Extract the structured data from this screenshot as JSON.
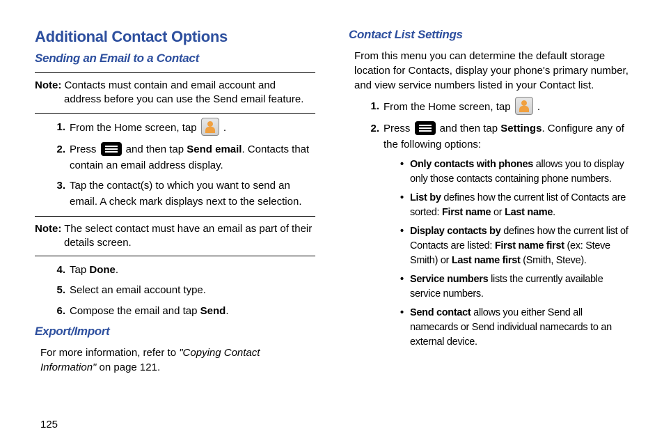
{
  "left": {
    "h1": "Additional Contact Options",
    "h2a": "Sending an Email to a Contact",
    "note1_label": "Note:",
    "note1_text": " Contacts must contain and email account and address before you can use the Send email feature.",
    "steps1": {
      "s1a": "From the Home screen, tap ",
      "s1b": " .",
      "s2a": "Press ",
      "s2b": " and then tap ",
      "s2bold": "Send email",
      "s2c": ". Contacts that contain an email address display.",
      "s3": "Tap the contact(s) to which you want to send an email. A check mark displays next to the selection."
    },
    "note2_label": "Note:",
    "note2_text": " The select contact must have an email as part of their details screen.",
    "steps2": {
      "s4a": "Tap ",
      "s4bold": "Done",
      "s4b": ".",
      "s5": "Select an email account type.",
      "s6a": "Compose the email and tap ",
      "s6bold": "Send",
      "s6b": "."
    },
    "h2b": "Export/Import",
    "expa": "For more information, refer to ",
    "expi": "\"Copying Contact Information\"",
    "expb": " on page 121."
  },
  "right": {
    "h2": "Contact List Settings",
    "intro": "From this menu you can determine the default storage location for Contacts, display your phone's primary number, and view service numbers listed in your Contact list.",
    "s1a": "From the Home screen, tap ",
    "s1b": " .",
    "s2a": "Press ",
    "s2b": " and then tap ",
    "s2bold": "Settings",
    "s2c": ". Configure any of the following options:",
    "b1bold": "Only contacts with phones",
    "b1": " allows you to display only those contacts containing phone numbers.",
    "b2bold": "List by",
    "b2a": " defines how the current list of Contacts are sorted: ",
    "b2b1": "First name",
    "b2or": " or ",
    "b2b2": "Last name",
    "b2b": ".",
    "b3bold": "Display contacts by",
    "b3a": " defines how the current list of Contacts are listed: ",
    "b3b1": "First name first",
    "b3p1": " (ex: Steve Smith) or ",
    "b3b2": "Last name first",
    "b3p2": " (Smith, Steve).",
    "b4bold": "Service numbers",
    "b4": " lists the currently available service numbers.",
    "b5bold": "Send contact",
    "b5": " allows you either Send all namecards or Send individual namecards to an external device."
  },
  "pagenum": "125"
}
